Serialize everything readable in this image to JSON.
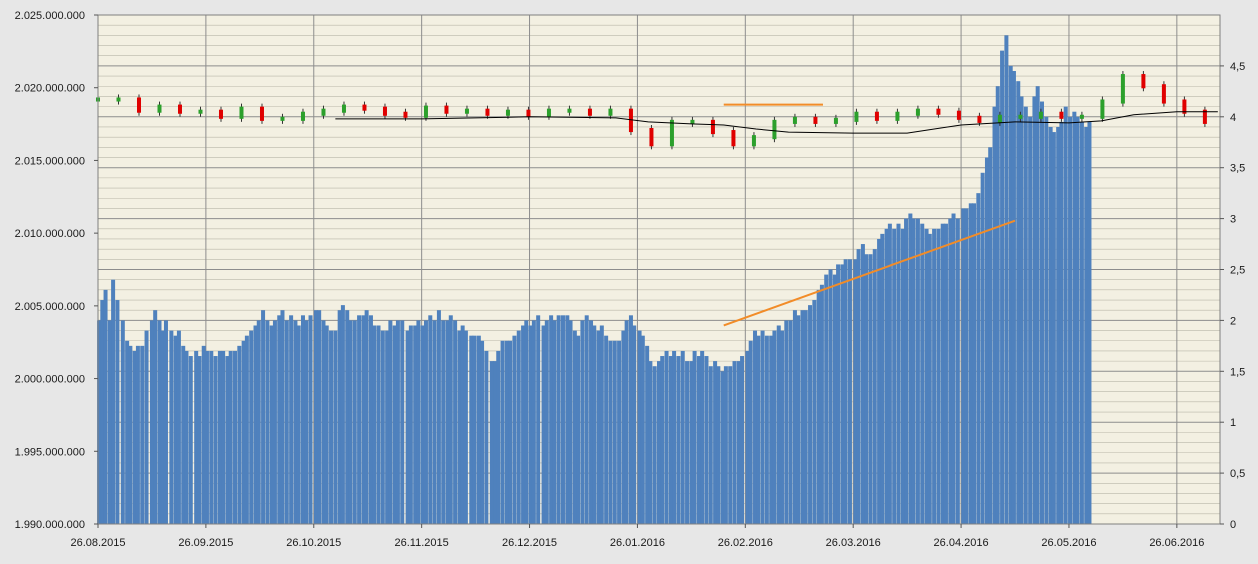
{
  "chart_data": {
    "type": "bar",
    "title": "",
    "xlabel": "",
    "ylabel": "",
    "colors": {
      "plot_background": "#f3f0e2",
      "outer_background": "#e7e7e7",
      "bars": "#4f81bd",
      "candle_up": "#2ca02c",
      "candle_down": "#e00000",
      "moving_average": "#000000",
      "trend_lines": "#f28c28",
      "grid": "#9a9a9a"
    },
    "grid": true,
    "y_left": {
      "ylim": [
        1990000000,
        2025000000
      ],
      "ticks": [
        1990000000,
        1995000000,
        2000000000,
        2005000000,
        2010000000,
        2015000000,
        2020000000,
        2025000000
      ],
      "tick_labels": [
        "1.990.000.000",
        "1.995.000.000",
        "2.000.000.000",
        "2.005.000.000",
        "2.010.000.000",
        "2.015.000.000",
        "2.020.000.000",
        "2.025.000.000"
      ]
    },
    "y_right": {
      "ylim": [
        0,
        5
      ],
      "ticks": [
        0,
        0.5,
        1,
        1.5,
        2,
        2.5,
        3,
        3.5,
        4,
        4.5
      ],
      "tick_labels": [
        "0",
        "0,5",
        "1",
        "1,5",
        "2",
        "2,5",
        "3",
        "3,5",
        "4",
        "4,5"
      ]
    },
    "x_tick_labels": [
      "26.08.2015",
      "26.09.2015",
      "26.10.2015",
      "26.11.2015",
      "26.12.2015",
      "26.01.2016",
      "26.02.2016",
      "26.03.2016",
      "26.04.2016",
      "26.05.2016",
      "26.06.2016"
    ],
    "x_tick_positions": [
      0,
      1,
      2,
      3,
      4,
      5,
      6,
      7,
      8,
      9,
      10
    ],
    "x_range": [
      0,
      10.4
    ],
    "bar_series": {
      "x": [
        0.01,
        0.04,
        0.07,
        0.11,
        0.14,
        0.18,
        0.23,
        0.27,
        0.3,
        0.34,
        0.37,
        0.41,
        0.45,
        0.5,
        0.53,
        0.57,
        0.6,
        0.63,
        0.68,
        0.72,
        0.75,
        0.79,
        0.82,
        0.86,
        0.91,
        0.94,
        0.98,
        1.01,
        1.05,
        1.09,
        1.13,
        1.16,
        1.2,
        1.23,
        1.27,
        1.31,
        1.35,
        1.38,
        1.42,
        1.46,
        1.49,
        1.53,
        1.57,
        1.61,
        1.64,
        1.68,
        1.71,
        1.75,
        1.79,
        1.83,
        1.86,
        1.9,
        1.93,
        1.97,
        2.02,
        2.05,
        2.09,
        2.12,
        2.16,
        2.2,
        2.24,
        2.27,
        2.31,
        2.34,
        2.38,
        2.42,
        2.46,
        2.49,
        2.53,
        2.56,
        2.6,
        2.64,
        2.68,
        2.71,
        2.75,
        2.78,
        2.82,
        2.87,
        2.9,
        2.94,
        2.97,
        3.01,
        3.04,
        3.08,
        3.12,
        3.16,
        3.2,
        3.24,
        3.27,
        3.31,
        3.35,
        3.38,
        3.41,
        3.46,
        3.49,
        3.53,
        3.56,
        3.6,
        3.65,
        3.68,
        3.71,
        3.75,
        3.79,
        3.82,
        3.86,
        3.9,
        3.94,
        3.97,
        4.01,
        4.04,
        4.08,
        4.13,
        4.16,
        4.2,
        4.23,
        4.27,
        4.31,
        4.35,
        4.38,
        4.42,
        4.45,
        4.49,
        4.53,
        4.57,
        4.6,
        4.64,
        4.67,
        4.71,
        4.75,
        4.79,
        4.83,
        4.87,
        4.9,
        4.94,
        4.97,
        5.02,
        5.05,
        5.09,
        5.12,
        5.16,
        5.2,
        5.23,
        5.27,
        5.31,
        5.34,
        5.38,
        5.42,
        5.46,
        5.5,
        5.53,
        5.57,
        5.6,
        5.64,
        5.68,
        5.72,
        5.75,
        5.79,
        5.82,
        5.86,
        5.9,
        5.94,
        5.97,
        6.02,
        6.05,
        6.09,
        6.12,
        6.16,
        6.2,
        6.24,
        6.27,
        6.31,
        6.34,
        6.38,
        6.42,
        6.46,
        6.49,
        6.53,
        6.56,
        6.6,
        6.64,
        6.68,
        6.71,
        6.75,
        6.79,
        6.83,
        6.86,
        6.9,
        6.93,
        6.97,
        7.02,
        7.05,
        7.09,
        7.12,
        7.16,
        7.2,
        7.24,
        7.27,
        7.31,
        7.34,
        7.38,
        7.42,
        7.46,
        7.49,
        7.53,
        7.56,
        7.6,
        7.64,
        7.68,
        7.71,
        7.75,
        7.79,
        7.83,
        7.86,
        7.9,
        7.93,
        7.97,
        8.02,
        8.05,
        8.09,
        8.12,
        8.16,
        8.2,
        8.24,
        8.27,
        8.31,
        8.34,
        8.38,
        8.42,
        8.46,
        8.49,
        8.53,
        8.56,
        8.6,
        8.64,
        8.68,
        8.71,
        8.75,
        8.79,
        8.83,
        8.86,
        8.9,
        8.93,
        8.97,
        9.01,
        9.05,
        9.08,
        9.12,
        9.16,
        9.19,
        9.23,
        9.27,
        9.31,
        9.34,
        9.38,
        9.42,
        9.46,
        9.49,
        9.53,
        9.57,
        9.6,
        9.64,
        9.68,
        9.72,
        9.75,
        9.79,
        9.83,
        9.87,
        9.9,
        9.94,
        9.97,
        10.01,
        10.05,
        10.09,
        10.12,
        10.16,
        10.2,
        10.23,
        10.27,
        10.31,
        10.34,
        10.38
      ],
      "values": [
        2.0,
        2.2,
        2.3,
        2.0,
        2.4,
        2.2,
        2.0,
        1.8,
        1.75,
        1.7,
        1.75,
        1.75,
        1.9,
        2.0,
        2.1,
        2.0,
        1.9,
        2.0,
        1.9,
        1.85,
        1.9,
        1.75,
        1.7,
        1.65,
        1.7,
        1.65,
        1.75,
        1.7,
        1.7,
        1.65,
        1.7,
        1.7,
        1.65,
        1.7,
        1.7,
        1.75,
        1.8,
        1.85,
        1.9,
        1.95,
        2.0,
        2.1,
        2.0,
        1.95,
        2.0,
        2.05,
        2.1,
        2.0,
        2.05,
        2.0,
        1.95,
        2.05,
        2.0,
        2.05,
        2.1,
        2.1,
        2.0,
        1.95,
        1.9,
        1.9,
        2.1,
        2.15,
        2.1,
        2.0,
        2.0,
        2.05,
        2.05,
        2.1,
        2.05,
        1.95,
        1.95,
        1.9,
        1.9,
        2.0,
        1.95,
        2.0,
        2.0,
        1.9,
        1.95,
        1.95,
        2.0,
        1.95,
        2.0,
        2.05,
        2.0,
        2.1,
        2.0,
        2.0,
        2.05,
        2.0,
        1.9,
        1.95,
        1.9,
        1.85,
        1.85,
        1.85,
        1.8,
        1.7,
        1.6,
        1.6,
        1.7,
        1.8,
        1.8,
        1.8,
        1.85,
        1.9,
        1.95,
        2.0,
        1.95,
        2.0,
        2.05,
        1.95,
        2.0,
        2.05,
        2.0,
        2.05,
        2.05,
        2.05,
        2.0,
        1.9,
        1.85,
        2.0,
        2.05,
        2.0,
        1.95,
        1.9,
        1.95,
        1.85,
        1.8,
        1.8,
        1.8,
        1.9,
        2.0,
        2.05,
        1.95,
        1.9,
        1.85,
        1.75,
        1.6,
        1.55,
        1.6,
        1.65,
        1.7,
        1.65,
        1.7,
        1.65,
        1.7,
        1.6,
        1.6,
        1.7,
        1.65,
        1.7,
        1.65,
        1.55,
        1.6,
        1.55,
        1.5,
        1.55,
        1.55,
        1.6,
        1.6,
        1.65,
        1.7,
        1.8,
        1.9,
        1.85,
        1.9,
        1.85,
        1.85,
        1.9,
        1.95,
        1.9,
        2.0,
        2.0,
        2.1,
        2.05,
        2.1,
        2.1,
        2.15,
        2.2,
        2.3,
        2.35,
        2.45,
        2.5,
        2.45,
        2.55,
        2.55,
        2.6,
        2.6,
        2.6,
        2.7,
        2.75,
        2.65,
        2.65,
        2.7,
        2.8,
        2.85,
        2.9,
        2.95,
        2.9,
        2.95,
        2.9,
        3.0,
        3.05,
        3.0,
        3.0,
        2.95,
        2.9,
        2.85,
        2.9,
        2.9,
        2.95,
        2.95,
        3.0,
        3.05,
        3.0,
        3.1,
        3.1,
        3.15,
        3.15,
        3.25,
        3.45,
        3.6,
        3.7,
        4.1,
        4.3,
        4.65,
        4.8,
        4.5,
        4.45,
        4.35,
        4.2,
        4.1,
        4.0,
        4.2,
        4.3,
        4.15,
        4.0,
        3.9,
        3.85,
        3.9,
        3.95,
        4.1,
        4.0,
        4.05,
        4.0,
        3.95,
        3.9,
        3.95
      ]
    },
    "candlestick_series": {
      "x": [
        0.0,
        0.19,
        0.38,
        0.57,
        0.76,
        0.95,
        1.14,
        1.33,
        1.52,
        1.71,
        1.9,
        2.09,
        2.28,
        2.47,
        2.66,
        2.85,
        3.04,
        3.23,
        3.42,
        3.61,
        3.8,
        3.99,
        4.18,
        4.37,
        4.56,
        4.75,
        4.94,
        5.13,
        5.32,
        5.51,
        5.7,
        5.89,
        6.08,
        6.27,
        6.46,
        6.65,
        6.84,
        7.03,
        7.22,
        7.41,
        7.6,
        7.79,
        7.98,
        8.17,
        8.36,
        8.55,
        8.74,
        8.93,
        9.12,
        9.31,
        9.5,
        9.69,
        9.88,
        10.07,
        10.26
      ],
      "values": [
        4.17,
        4.17,
        4.06,
        4.1,
        4.05,
        4.05,
        4.0,
        4.08,
        3.98,
        3.98,
        4.03,
        4.06,
        4.1,
        4.08,
        4.03,
        4.01,
        4.09,
        4.05,
        4.06,
        4.03,
        4.05,
        4.02,
        4.06,
        4.06,
        4.03,
        4.06,
        3.87,
        3.73,
        3.95,
        3.95,
        3.85,
        3.73,
        3.8,
        3.95,
        3.98,
        3.95,
        3.97,
        4.03,
        3.98,
        4.03,
        4.06,
        4.04,
        3.99,
        3.96,
        4.0,
        4.0,
        4.03,
        4.0,
        4.0,
        4.15,
        4.4,
        4.3,
        4.15,
        4.05,
        3.95
      ]
    },
    "moving_average": {
      "x": [
        2.2,
        3.0,
        4.0,
        4.8,
        5.1,
        5.5,
        5.8,
        6.1,
        6.4,
        7.0,
        7.5,
        8.0,
        8.5,
        9.0,
        9.3,
        9.6,
        10.0,
        10.38
      ],
      "values": [
        3.98,
        3.98,
        4.0,
        3.99,
        3.95,
        3.93,
        3.92,
        3.88,
        3.85,
        3.84,
        3.84,
        3.92,
        3.95,
        3.94,
        3.96,
        4.02,
        4.05,
        4.05
      ]
    },
    "annotations": [
      {
        "type": "trend_line",
        "x": [
          5.8,
          6.72
        ],
        "values": [
          4.12,
          4.12
        ]
      },
      {
        "type": "trend_line",
        "x": [
          5.8,
          8.5
        ],
        "values": [
          1.95,
          2.98
        ]
      }
    ]
  }
}
